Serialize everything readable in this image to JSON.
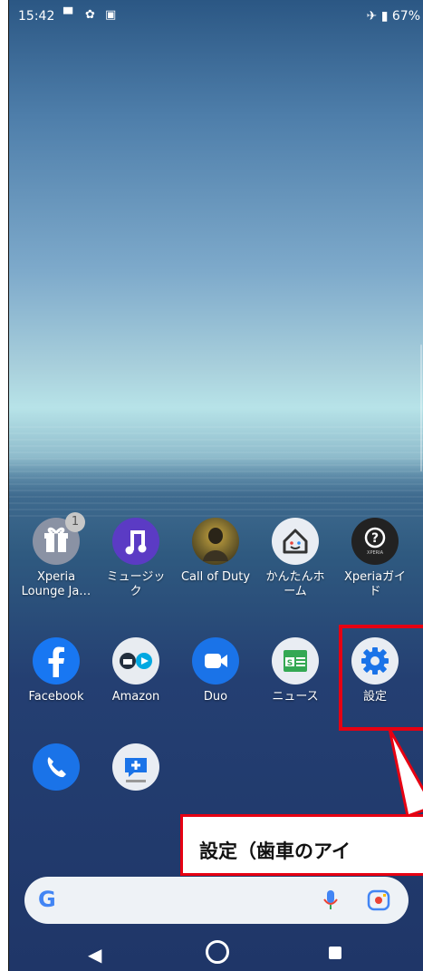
{
  "status_bar": {
    "time": "15:42",
    "battery": "67%"
  },
  "apps_row1": [
    {
      "label": "Xperia\nLounge Ja…",
      "icon": "gift-icon",
      "badge": "1"
    },
    {
      "label": "ミュージッ\nク",
      "icon": "music-note-icon"
    },
    {
      "label": "Call of Duty",
      "icon": "soldier-icon"
    },
    {
      "label": "かんたんホ\nーム",
      "icon": "home-face-icon"
    },
    {
      "label": "Xperiaガイ\nド",
      "icon": "question-icon"
    }
  ],
  "apps_row2": [
    {
      "label": "Facebook",
      "icon": "facebook-icon"
    },
    {
      "label": "Amazon",
      "icon": "amazon-icon"
    },
    {
      "label": "Duo",
      "icon": "video-camera-icon"
    },
    {
      "label": "ニュース",
      "icon": "news-icon"
    },
    {
      "label": "設定",
      "icon": "gear-icon"
    }
  ],
  "dock": [
    {
      "icon": "phone-icon"
    },
    {
      "icon": "softbank-message-icon"
    }
  ],
  "callout": {
    "text": "設定（歯車のアイ"
  },
  "search": {
    "logo": "G"
  },
  "colors": {
    "accent_red": "#e60012",
    "google_blue": "#4285f4"
  }
}
